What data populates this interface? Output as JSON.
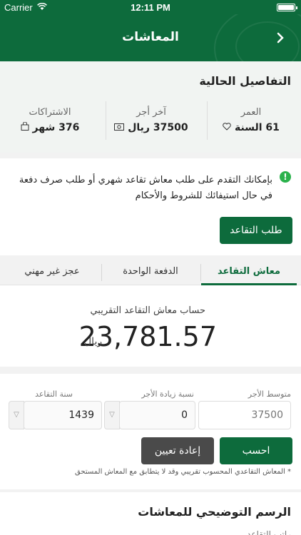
{
  "status_bar": {
    "carrier": "Carrier",
    "time": "12:11 PM"
  },
  "navbar": {
    "title": "المعاشات"
  },
  "details": {
    "heading": "التفاصيل الحالية",
    "age": {
      "label": "العمر",
      "value": "61 السنة",
      "icon": "heart-icon"
    },
    "last_salary": {
      "label": "آخر أجر",
      "value": "37500 ريال",
      "icon": "money-icon"
    },
    "subscriptions": {
      "label": "الاشتراكات",
      "value": "376 شهر",
      "icon": "bag-icon"
    }
  },
  "notice": {
    "text": "بإمكانك التقدم على طلب معاش تقاعد شهري أو طلب صرف دفعة في حال استيفائك للشروط والأحكام",
    "button": "طلب التقاعد"
  },
  "tabs": [
    "معاش التقاعد",
    "الدفعة الواحدة",
    "عجز غير مهني"
  ],
  "result": {
    "label": "حساب معاش التقاعد التقريبي",
    "amount": "23,781.57",
    "unit": "ريال"
  },
  "form": {
    "avg_salary": {
      "label": "متوسط الأجر",
      "placeholder": "37500"
    },
    "raise_rate": {
      "label": "نسبة زيادة الأجر",
      "value": "0"
    },
    "retire_year": {
      "label": "سنة التقاعد",
      "value": "1439"
    },
    "calculate": "احسب",
    "reset": "إعادة تعيين",
    "note": "* المعاش التقاعدي المحسوب تقريبي وقد لا يتطابق مع المعاش المستحق"
  },
  "chart_section": {
    "heading": "الرسم التوضيحي للمعاشات",
    "subtitle": "راتب التقاعد"
  },
  "colors": {
    "primary": "#0d6b3c",
    "success_icon": "#2bb24c",
    "reset_button": "#4a4a4a"
  }
}
